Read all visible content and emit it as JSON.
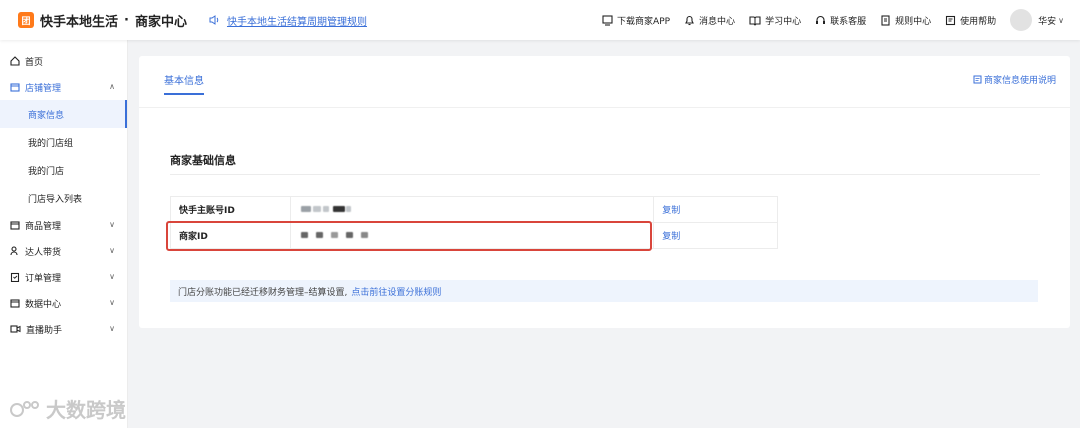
{
  "header": {
    "logo_glyph": "团",
    "brand": "快手本地生活",
    "dot": "·",
    "subtitle": "商家中心",
    "notice": "快手本地生活结算周期管理规则",
    "nav": [
      {
        "icon": "monitor-icon",
        "label": "下载商家APP"
      },
      {
        "icon": "bell-icon",
        "label": "消息中心"
      },
      {
        "icon": "book-icon",
        "label": "学习中心"
      },
      {
        "icon": "headset-icon",
        "label": "联系客服"
      },
      {
        "icon": "rules-icon",
        "label": "规则中心"
      },
      {
        "icon": "help-icon",
        "label": "使用帮助"
      }
    ],
    "user": "华安"
  },
  "sidebar": {
    "home": "首页",
    "store_mgmt": "店铺管理",
    "sub": [
      "商家信息",
      "我的门店组",
      "我的门店",
      "门店导入列表"
    ],
    "groups": [
      "商品管理",
      "达人带货",
      "订单管理",
      "数据中心",
      "直播助手"
    ]
  },
  "main": {
    "tab": "基本信息",
    "help_link": "商家信息使用说明",
    "section_title": "商家基础信息",
    "rows": [
      {
        "key": "快手主账号ID",
        "action": "复制"
      },
      {
        "key": "商家ID",
        "action": "复制"
      }
    ],
    "notice_text": "门店分账功能已经迁移财务管理–结算设置,",
    "notice_link": "点击前往设置分账规则"
  },
  "watermark": "大数跨境",
  "colors": {
    "accent": "#3a6fd8",
    "highlight": "#d9453b",
    "logo": "#ff7a1a"
  }
}
